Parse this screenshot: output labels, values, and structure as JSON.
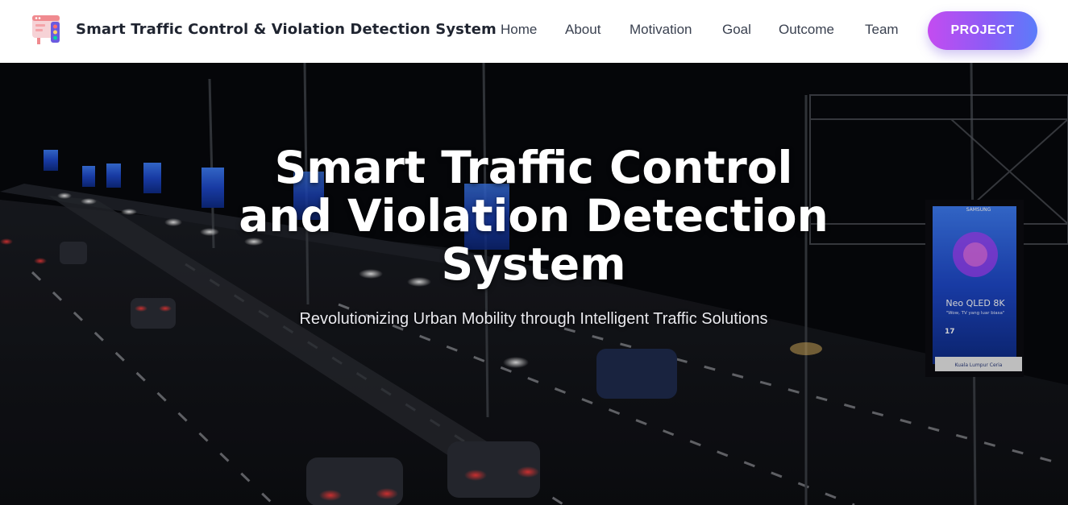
{
  "header": {
    "logo_icon": "traffic-dashboard-icon",
    "brand": "Smart Traffic Control & Violation Detection System",
    "nav": [
      {
        "id": "home",
        "label": "Home"
      },
      {
        "id": "about",
        "label": "About"
      },
      {
        "id": "motivation",
        "label": "Motivation"
      },
      {
        "id": "goal",
        "label": "Goal"
      },
      {
        "id": "outcome",
        "label": "Outcome"
      },
      {
        "id": "team",
        "label": "Team"
      }
    ],
    "cta_label": "PROJECT"
  },
  "hero": {
    "title_line1": "Smart Traffic Control",
    "title_line2": "and Violation Detection",
    "title_line3": "System",
    "subtitle": "Revolutionizing Urban Mobility through Intelligent Traffic Solutions",
    "billboard": {
      "brand": "SAMSUNG",
      "product": "Neo QLED 8K",
      "tagline": "\"Wow, TV yang luar biasa\"",
      "number": "17",
      "footer": "Kuala Lumpur Ceria"
    }
  },
  "colors": {
    "header_bg": "#ffffff",
    "brand_text": "#1f2430",
    "nav_text": "#3a4150",
    "cta_gradient_start": "#c44cf0",
    "cta_gradient_end": "#5b7cfa",
    "hero_text": "#ffffff"
  }
}
